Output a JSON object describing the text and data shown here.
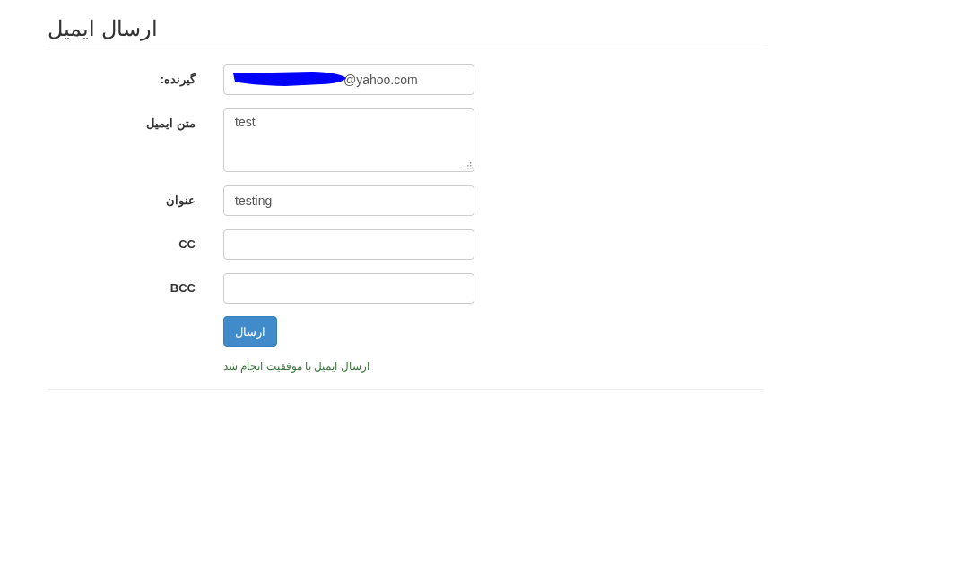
{
  "title": "ارسال ایمیل",
  "fields": [
    {
      "label": ":گیرنده",
      "kind": "input",
      "value": "@yahoo.com",
      "redacted": true
    },
    {
      "label": "متن ایمیل",
      "kind": "textarea",
      "value": "test",
      "redacted": false
    },
    {
      "label": "عنوان",
      "kind": "input",
      "value": "testing",
      "redacted": false
    },
    {
      "label": "CC",
      "kind": "input",
      "redacted": false
    },
    {
      "label": "BCC",
      "kind": "input",
      "redacted": false
    }
  ],
  "submit": "ارسال",
  "message": "ارسال ایمیل با موفقیت انجام شد"
}
